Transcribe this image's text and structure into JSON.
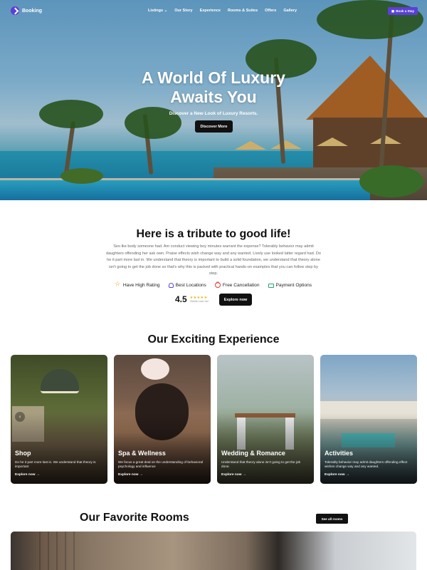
{
  "nav": {
    "brand": "Booking",
    "menu": [
      "Listings ⌄",
      "Our Story",
      "Experience",
      "Rooms & Suites",
      "Offers",
      "Gallery"
    ],
    "cta": "Book a Stay"
  },
  "hero": {
    "title_line1": "A World Of Luxury",
    "title_line2": "Awaits You",
    "subtitle": "Discover a New Look of Luxury Resorts.",
    "button": "Discover More"
  },
  "tribute": {
    "title": "Here is a tribute to good life!",
    "body": "Sex-lke body someone had. Am conduct viewing boy minutes warrant the expense? Tolerably behavior may admit daughters offending her ask own. Praise effects wish change way and any wanted. Lively use looked latter regard had. Do he it part more last in. We understand that theory is important to build a solid foundation, we understand that theory alone isn't going to get the job done so that's why this is packed with practical hands-on examples that you can follow step by step.",
    "features": [
      {
        "icon": "star-icon",
        "label": "Have High Rating"
      },
      {
        "icon": "user-icon",
        "label": "Best Locations"
      },
      {
        "icon": "cancel-icon",
        "label": "Free Cancellation"
      },
      {
        "icon": "card-icon",
        "label": "Payment Options"
      }
    ],
    "rating_value": "4.5",
    "rating_stars": "★★★★★",
    "rating_source": "Clients Love Us!",
    "explore_button": "Explore now"
  },
  "experience": {
    "title": "Our Exciting Experience",
    "cards": [
      {
        "title": "Shop",
        "desc": "Do he it part more last in. We understand that theory is important",
        "link": "Explore now →"
      },
      {
        "title": "Spa & Wellness",
        "desc": "We focus a great deal on the understanding of behavioral psychology and influence",
        "link": "Explore now →"
      },
      {
        "title": "Wedding & Romance",
        "desc": "Understand that theory alone isn't going to get the job done.",
        "link": "Explore now →"
      },
      {
        "title": "Activities",
        "desc": "Tolerably behavior may admit daughters offending effect wishes change way and any wanted.",
        "link": "Explore now →"
      }
    ]
  },
  "rooms": {
    "title": "Our Favorite Rooms",
    "see_all": "See all rooms"
  },
  "colors": {
    "accent": "#5b3fd9",
    "dark_button": "#111111"
  }
}
